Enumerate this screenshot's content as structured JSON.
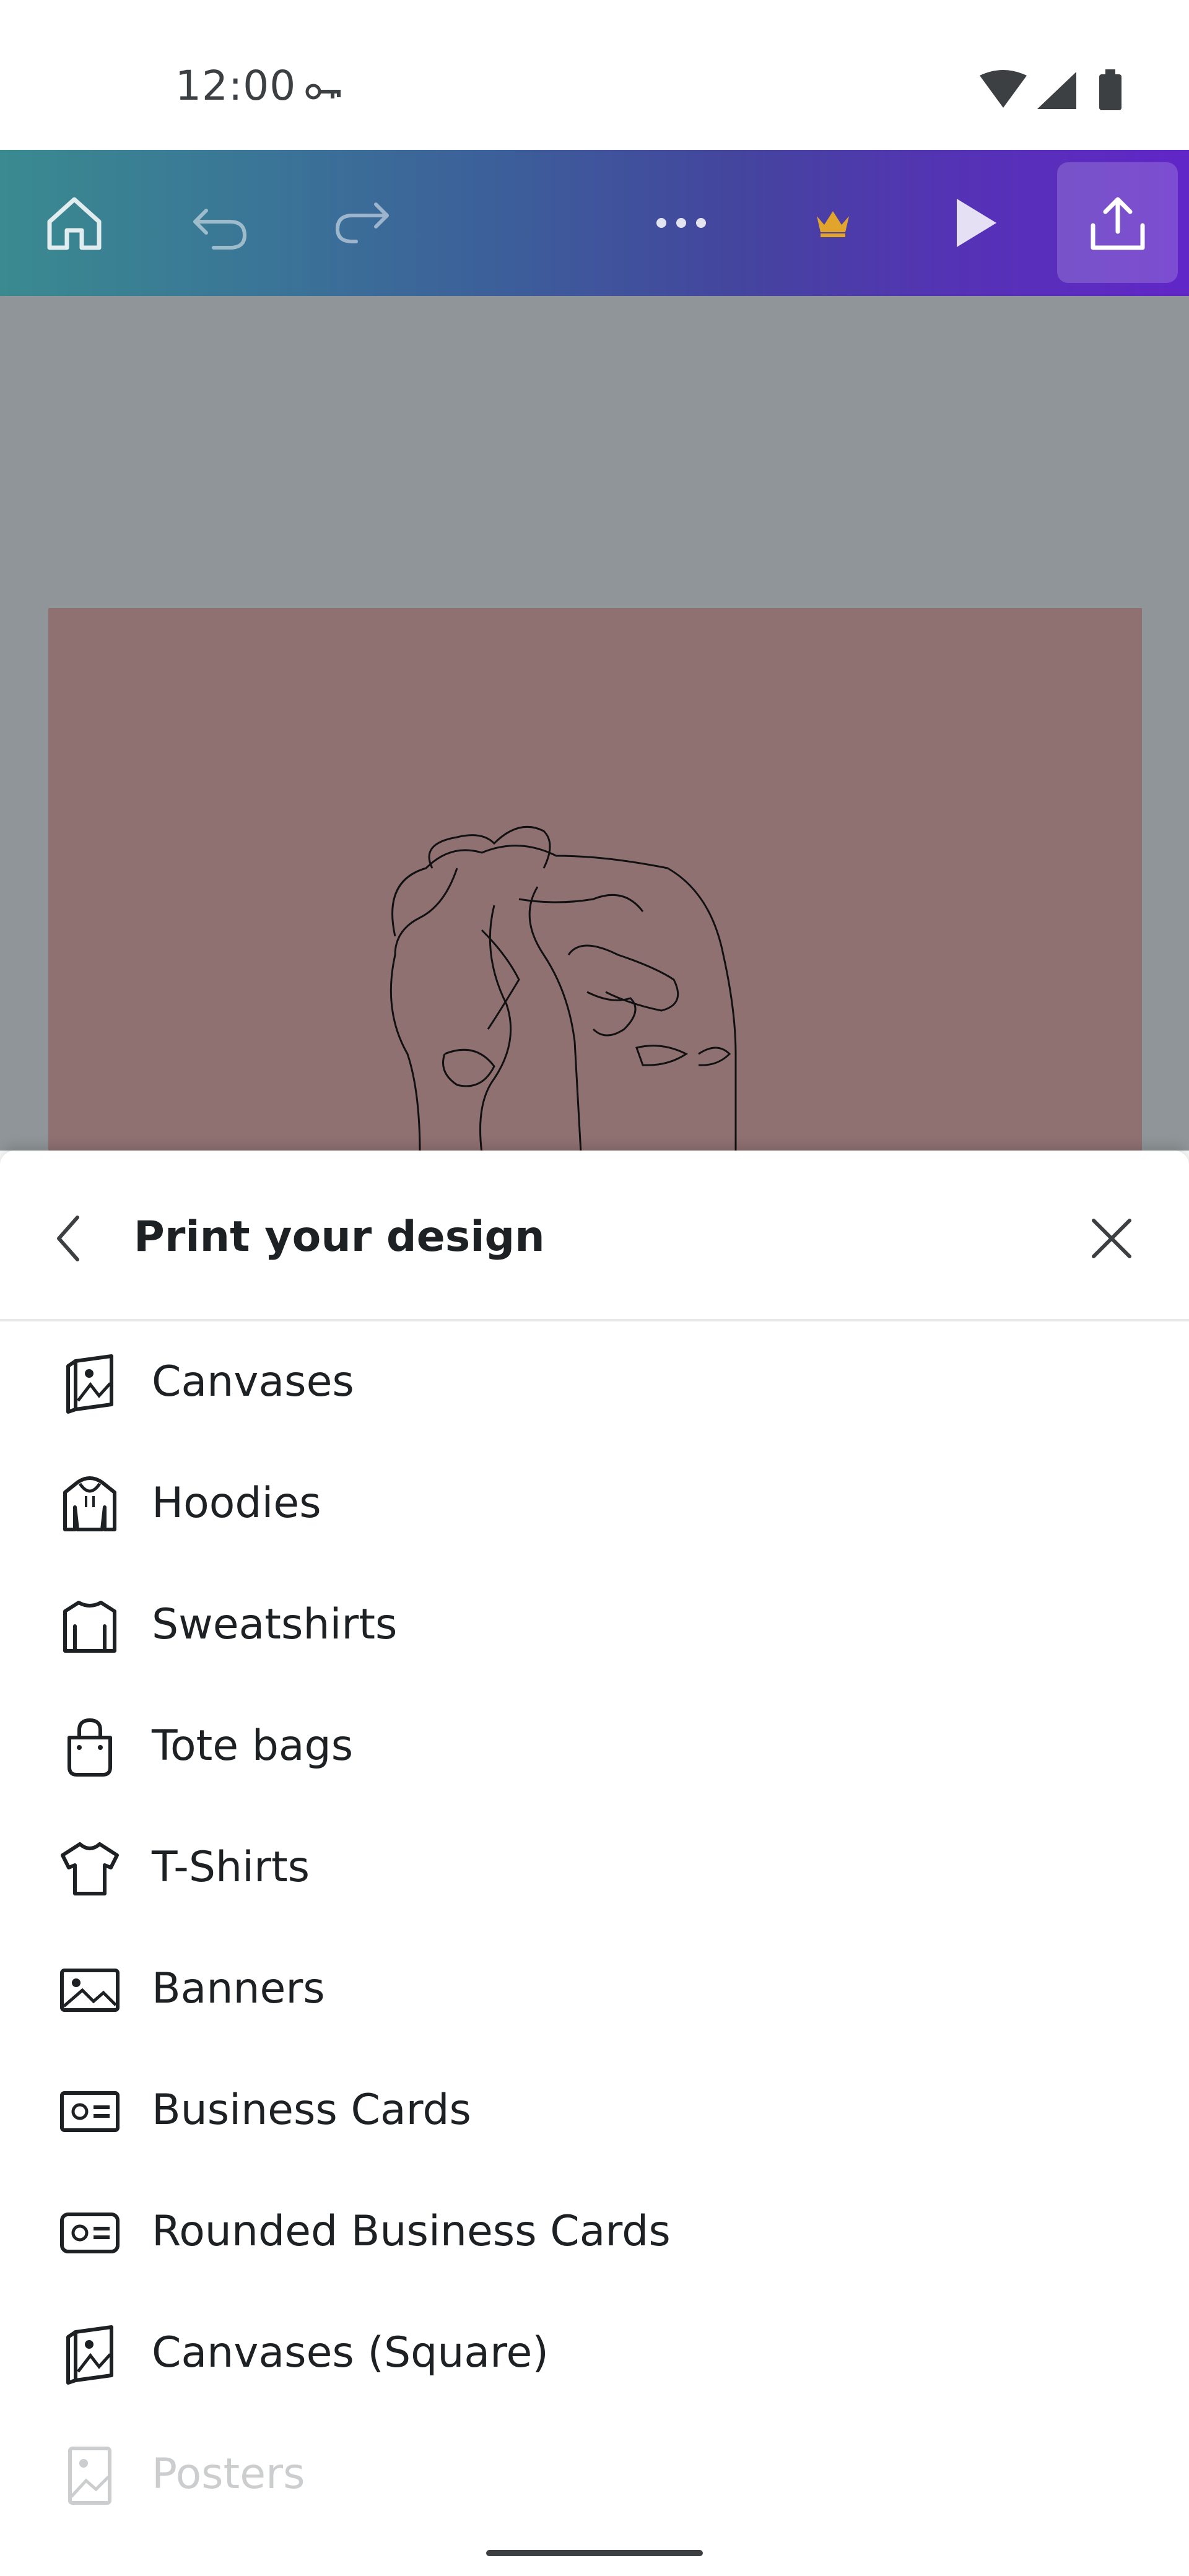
{
  "status_bar": {
    "time": "12:00",
    "icons": [
      "vpn-key-icon",
      "wifi-icon",
      "cellular-signal-icon",
      "battery-icon"
    ]
  },
  "toolbar": {
    "buttons": [
      "home-icon",
      "undo-icon",
      "redo-icon",
      "more-icon",
      "crown-icon",
      "play-icon",
      "share-icon"
    ],
    "colors": {
      "gradient_start": "#3a8a90",
      "gradient_end": "#6126c8",
      "crown": "#e2a52c"
    }
  },
  "design": {
    "page_color": "#907172",
    "artwork": "line-drawing-portrait"
  },
  "sheet": {
    "title": "Print your design",
    "items": [
      {
        "label": "Canvases",
        "icon": "canvas-icon"
      },
      {
        "label": "Hoodies",
        "icon": "hoodie-icon"
      },
      {
        "label": "Sweatshirts",
        "icon": "sweatshirt-icon"
      },
      {
        "label": "Tote bags",
        "icon": "tote-bag-icon"
      },
      {
        "label": "T-Shirts",
        "icon": "tshirt-icon"
      },
      {
        "label": "Banners",
        "icon": "banner-icon"
      },
      {
        "label": "Business Cards",
        "icon": "business-card-icon"
      },
      {
        "label": "Rounded Business Cards",
        "icon": "rounded-business-card-icon"
      },
      {
        "label": "Canvases (Square)",
        "icon": "canvas-square-icon"
      },
      {
        "label": "Posters",
        "icon": "poster-icon"
      }
    ]
  }
}
